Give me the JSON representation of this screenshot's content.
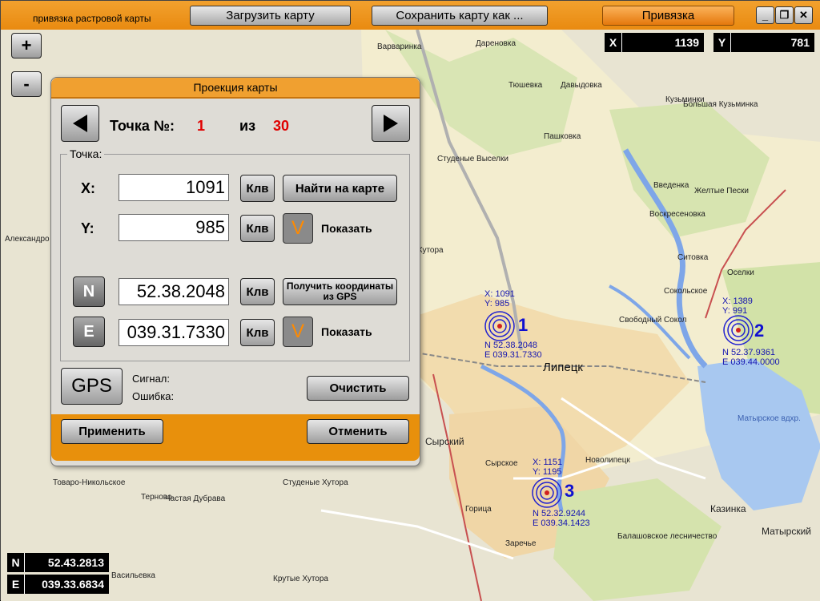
{
  "app": {
    "title": "привязка растровой карты"
  },
  "toolbar": {
    "load_label": "Загрузить карту",
    "save_label": "Сохранить карту как ...",
    "bind_label": "Привязка"
  },
  "window": {
    "minimize": "_",
    "restore": "❐",
    "close": "✕"
  },
  "cursor": {
    "x_label": "X",
    "x_value": "1139",
    "y_label": "Y",
    "y_value": "781"
  },
  "zoom": {
    "plus": "+",
    "minus": "-"
  },
  "latlon": {
    "n_label": "N",
    "n_value": "52.43.2813",
    "e_label": "E",
    "e_value": "039.33.6834"
  },
  "dialog": {
    "title": "Проекция карты",
    "point_label": "Точка №:",
    "point_index": "1",
    "of_label": "из",
    "point_total": "30",
    "group_title": "Точка:",
    "x_label": "X:",
    "x_value": "1091",
    "y_label": "Y:",
    "y_value": "985",
    "kbd_label": "Клв",
    "find_label": "Найти на карте",
    "show_label": "Показать",
    "n_label": "N",
    "n_value": "52.38.2048",
    "e_label": "E",
    "e_value": "039.31.7330",
    "gps_get_label": "Получить координаты из GPS",
    "gps_label": "GPS",
    "signal_label": "Сигнал:",
    "error_label": "Ошибка:",
    "clear_label": "Очистить",
    "apply_label": "Применить",
    "cancel_label": "Отменить",
    "check_glyph": "V"
  },
  "markers": [
    {
      "num": "1",
      "x_text": "X: 1091",
      "y_text": "Y: 985",
      "n_text": "N 52.38.2048",
      "e_text": "E 039.31.7330"
    },
    {
      "num": "2",
      "x_text": "X: 1389",
      "y_text": "Y: 991",
      "n_text": "N 52.37.9361",
      "e_text": "E 039.44.0000"
    },
    {
      "num": "3",
      "x_text": "X: 1151",
      "y_text": "Y: 1195",
      "n_text": "N 52.32.9244",
      "e_text": "E 039.34.1423"
    }
  ],
  "places": {
    "city": "Липецк",
    "p1": "Дареновка",
    "p2": "Варваринка",
    "p3": "Тюшевка",
    "p4": "Давыдовка",
    "p5": "Кузьминки",
    "p6": "Большая Кузьминка",
    "p7": "Пашковка",
    "p8": "Студеные Выселки",
    "p9": "Введенка",
    "p10": "Желтые Пески",
    "p11": "Воскресеновка",
    "p12": "Ситовка",
    "p13": "Оселки",
    "p14": "Сокольское",
    "p15": "Сырский",
    "p16": "Сырское",
    "p17": "Новолипецк",
    "p18": "Казинка",
    "p19": "Матырский",
    "p20": "Частая Дубрава",
    "p21": "Студеные Хутора",
    "p22": "Товаро-Никольское",
    "p23": "Терново",
    "p24": "Балашовское лесничество",
    "p25": "Крутые Хутора",
    "p26": "Васильевка",
    "p27": "Заречье",
    "p28": "Александро",
    "p29": "Хутора",
    "p30": "Свободный Сокол",
    "p31": "Горица",
    "p32": "Матырское вдхр."
  }
}
